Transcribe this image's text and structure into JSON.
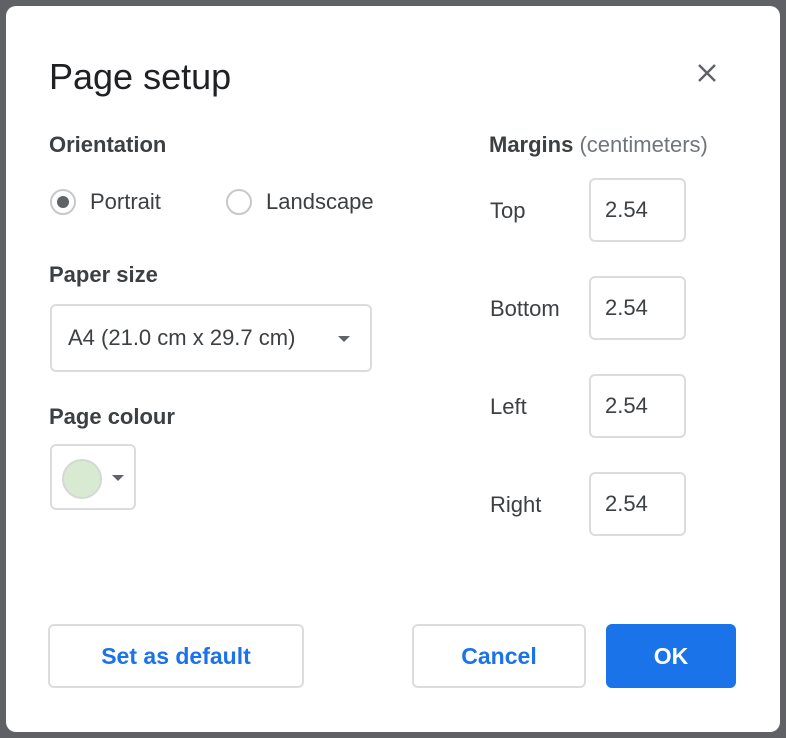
{
  "dialog": {
    "title": "Page setup",
    "orientation": {
      "label": "Orientation",
      "options": [
        {
          "label": "Portrait",
          "selected": true
        },
        {
          "label": "Landscape",
          "selected": false
        }
      ]
    },
    "paper_size": {
      "label": "Paper size",
      "value": "A4 (21.0 cm x 29.7 cm)"
    },
    "page_colour": {
      "label": "Page colour",
      "value": "#d9ead3"
    },
    "margins": {
      "label": "Margins",
      "unit": "(centimeters)",
      "fields": [
        {
          "label": "Top",
          "value": "2.54"
        },
        {
          "label": "Bottom",
          "value": "2.54"
        },
        {
          "label": "Left",
          "value": "2.54"
        },
        {
          "label": "Right",
          "value": "2.54"
        }
      ]
    },
    "buttons": {
      "set_default": "Set as default",
      "cancel": "Cancel",
      "ok": "OK"
    }
  },
  "colors": {
    "accent": "#1a73e8"
  }
}
